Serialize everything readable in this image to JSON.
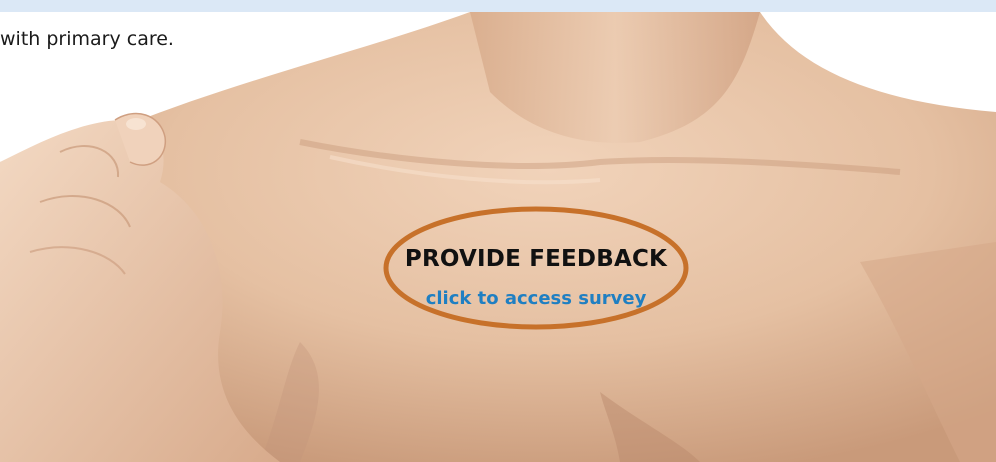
{
  "intro": {
    "text": "with primary care."
  },
  "feedback": {
    "title": "PROVIDE FEEDBACK",
    "link_text": "click to access survey"
  },
  "colors": {
    "top_band": "#dbe8f6",
    "ring": "#c7712a",
    "link": "#1f7fc2",
    "skin": "#e9c7aa"
  },
  "image": {
    "subject": "shoulder-and-chest-photo"
  }
}
